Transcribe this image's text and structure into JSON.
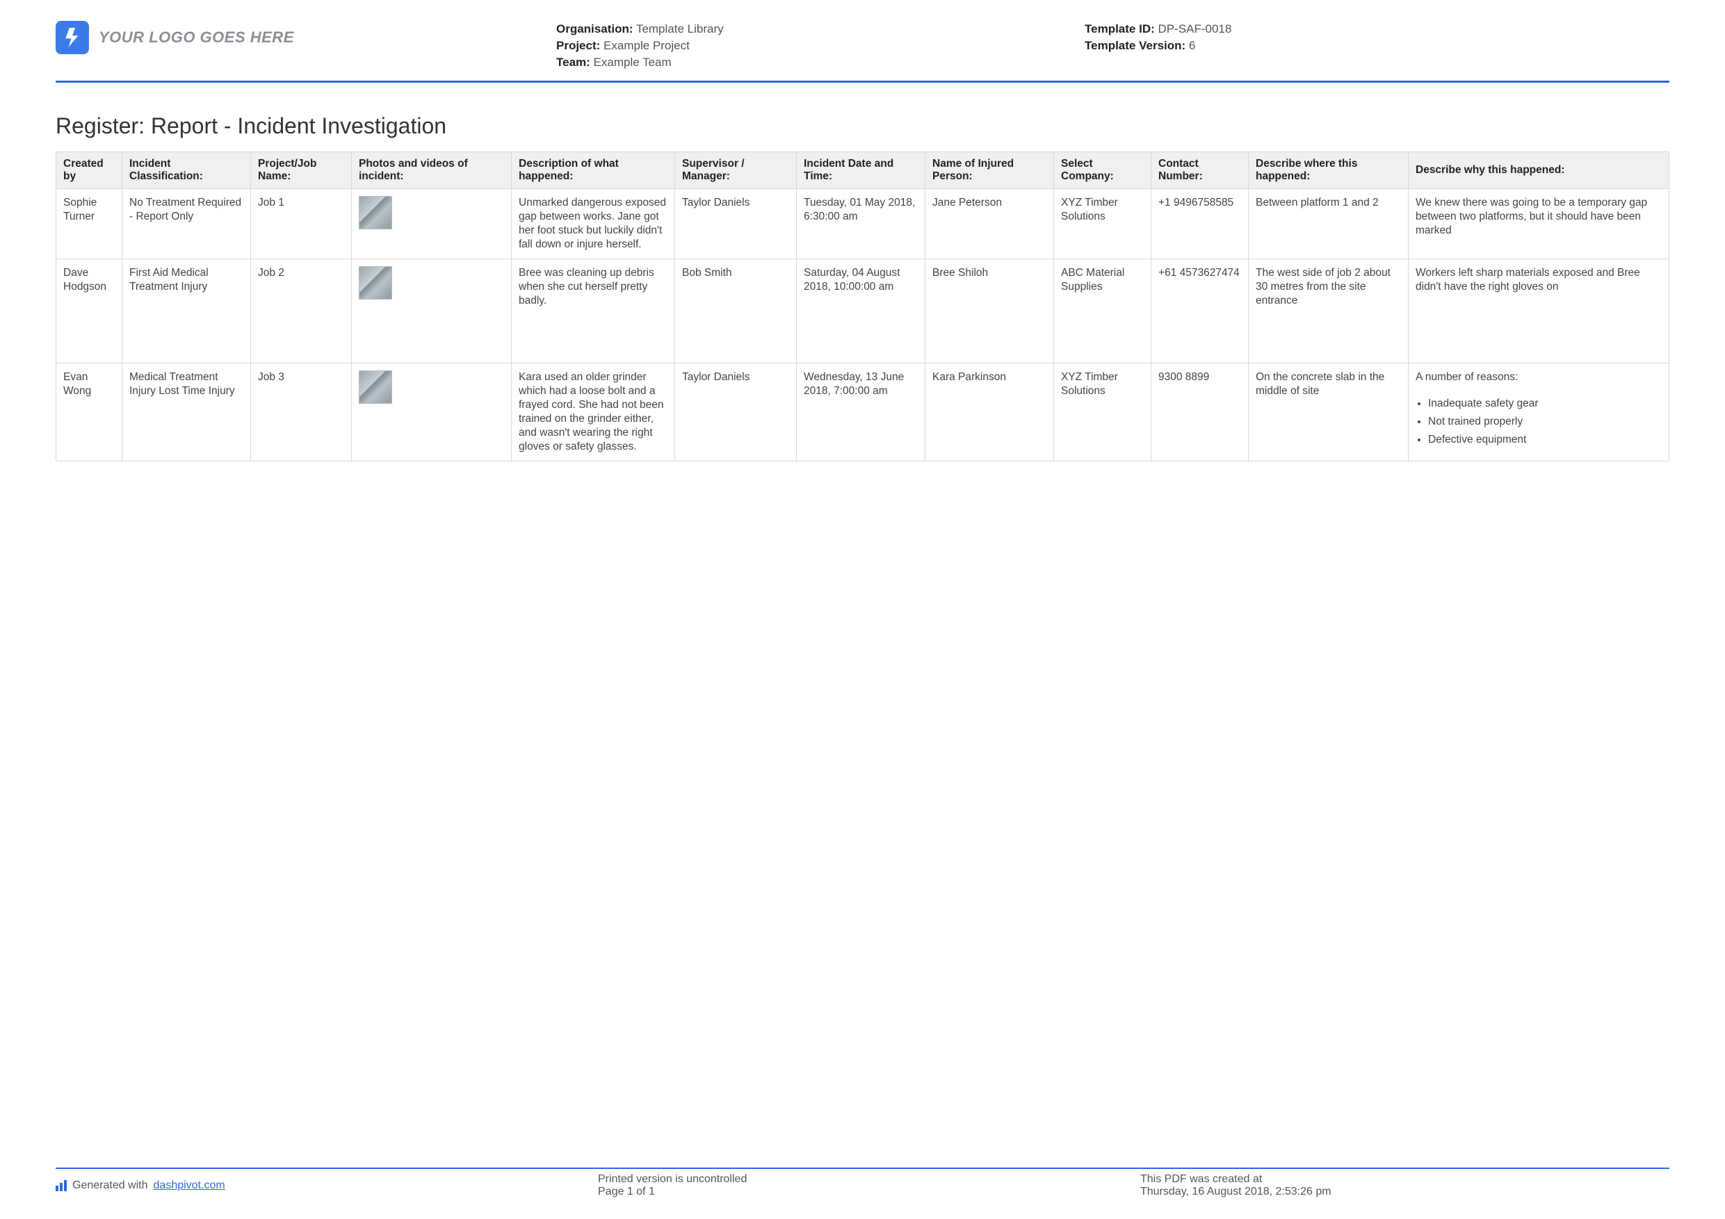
{
  "header": {
    "logo_text": "YOUR LOGO GOES HERE",
    "org_label": "Organisation:",
    "org_value": "Template Library",
    "project_label": "Project:",
    "project_value": "Example Project",
    "team_label": "Team:",
    "team_value": "Example Team",
    "template_id_label": "Template ID:",
    "template_id_value": "DP-SAF-0018",
    "template_ver_label": "Template Version:",
    "template_ver_value": "6"
  },
  "title": "Register: Report - Incident Investigation",
  "columns": {
    "c0": "Created by",
    "c1": "Incident Classification:",
    "c2": "Project/Job Name:",
    "c3": "Photos and videos of incident:",
    "c4": "Description of what happened:",
    "c5": "Supervisor / Manager:",
    "c6": "Incident Date and Time:",
    "c7": "Name of Injured Person:",
    "c8": "Select Company:",
    "c9": "Contact Number:",
    "c10": "Describe where this happened:",
    "c11": "Describe why this happened:"
  },
  "rows": [
    {
      "created_by": "Sophie Turner",
      "classification": "No Treatment Required - Report Only",
      "job": "Job 1",
      "description": "Unmarked dangerous exposed gap between works. Jane got her foot stuck but luckily didn't fall down or injure herself.",
      "supervisor": "Taylor Daniels",
      "datetime": "Tuesday, 01 May 2018, 6:30:00 am",
      "injured": "Jane Peterson",
      "company": "XYZ Timber Solutions",
      "contact": "+1 9496758585",
      "where": "Between platform 1 and 2",
      "why_text": "We knew there was going to be a temporary gap between two platforms, but it should have been marked",
      "why_list": []
    },
    {
      "created_by": "Dave Hodgson",
      "classification": "First Aid   Medical Treatment Injury",
      "job": "Job 2",
      "description": "Bree was cleaning up debris when she cut herself pretty badly.",
      "supervisor": "Bob Smith",
      "datetime": "Saturday, 04 August 2018, 10:00:00 am",
      "injured": "Bree Shiloh",
      "company": "ABC Material Supplies",
      "contact": "+61 4573627474",
      "where": "The west side of job 2 about 30 metres from the site entrance",
      "why_text": "Workers left sharp materials exposed and Bree didn't have the right gloves on",
      "why_list": []
    },
    {
      "created_by": "Evan Wong",
      "classification": "Medical Treatment Injury   Lost Time Injury",
      "job": "Job 3",
      "description": "Kara used an older grinder which had a loose bolt and a frayed cord. She had not been trained on the grinder either, and wasn't wearing the right gloves or safety glasses.",
      "supervisor": "Taylor Daniels",
      "datetime": "Wednesday, 13 June 2018, 7:00:00 am",
      "injured": "Kara Parkinson",
      "company": "XYZ Timber Solutions",
      "contact": "9300 8899",
      "where": "On the concrete slab in the middle of site",
      "why_text": "A number of reasons:",
      "why_list": [
        "Inadequate safety gear",
        "Not trained properly",
        "Defective equipment"
      ]
    }
  ],
  "footer": {
    "generated_prefix": "Generated with ",
    "generated_link": "dashpivot.com",
    "uncontrolled": "Printed version is uncontrolled",
    "page_info": "Page 1 of 1",
    "created_label": "This PDF was created at",
    "created_at": "Thursday, 16 August 2018, 2:53:26 pm"
  }
}
